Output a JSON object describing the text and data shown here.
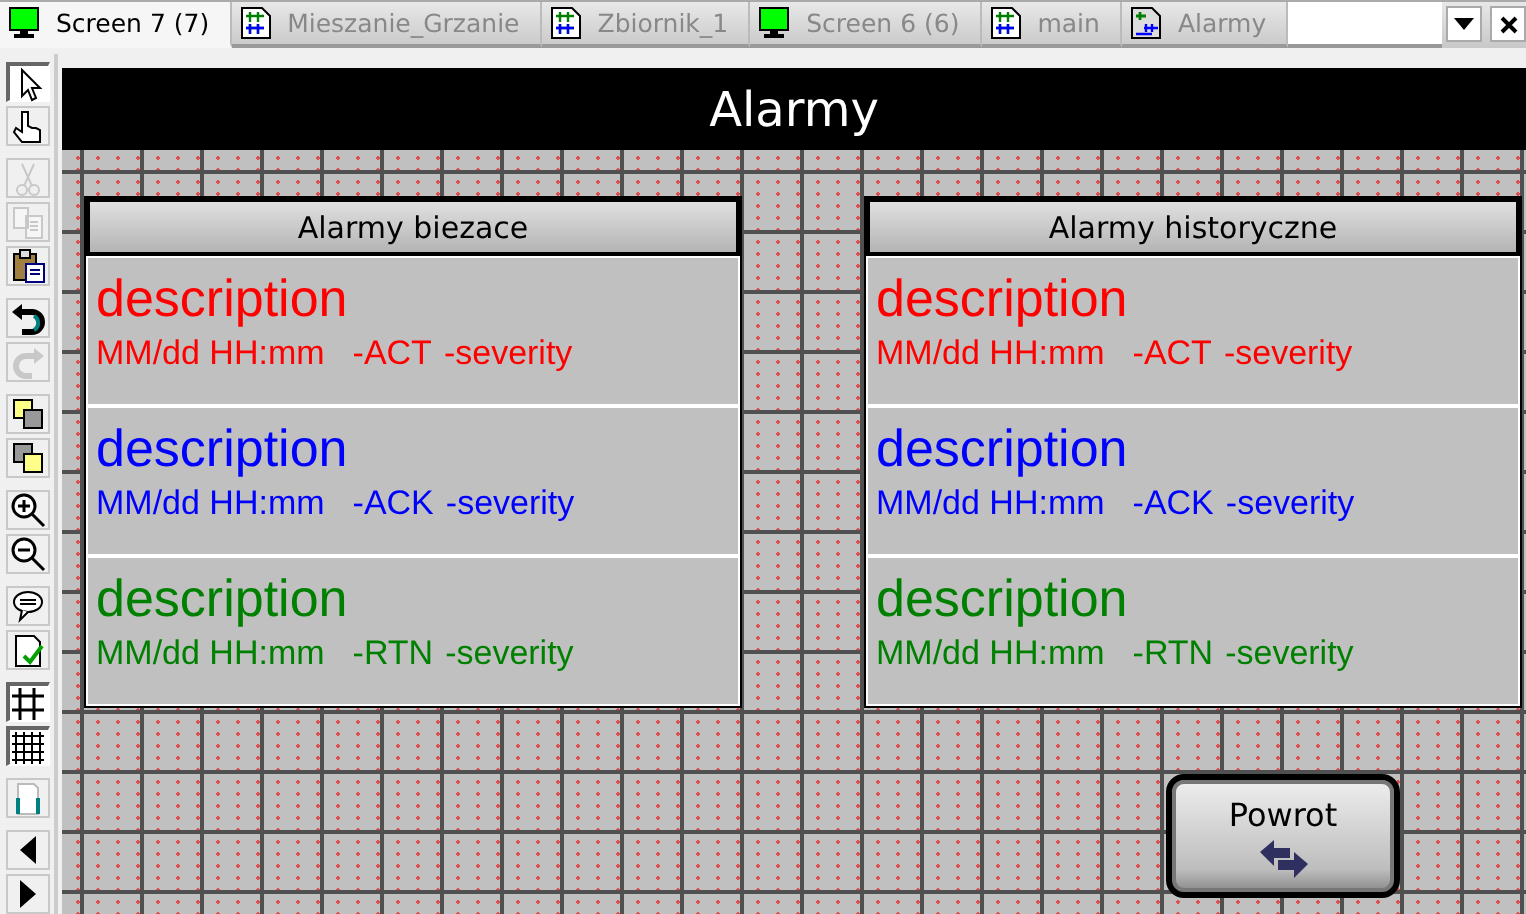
{
  "tabs": [
    {
      "label": "Screen 7 (7)",
      "kind": "screen",
      "selected": true
    },
    {
      "label": "Mieszanie_Grzanie",
      "kind": "ladder",
      "selected": false
    },
    {
      "label": "Zbiornik_1",
      "kind": "ladder",
      "selected": false
    },
    {
      "label": "Screen 6 (6)",
      "kind": "screen",
      "selected": false
    },
    {
      "label": "main",
      "kind": "ladder",
      "selected": false
    },
    {
      "label": "Alarmy",
      "kind": "alarm",
      "selected": false
    }
  ],
  "toolbar": [
    {
      "tools": [
        {
          "kind": "pointer",
          "pressed": true,
          "disabled": false
        },
        {
          "kind": "hand",
          "pressed": false,
          "disabled": false
        }
      ]
    },
    {
      "tools": [
        {
          "kind": "cut",
          "pressed": false,
          "disabled": true
        },
        {
          "kind": "copy",
          "pressed": false,
          "disabled": true
        },
        {
          "kind": "paste",
          "pressed": false,
          "disabled": false
        }
      ]
    },
    {
      "tools": [
        {
          "kind": "undo",
          "pressed": false,
          "disabled": false
        },
        {
          "kind": "redo",
          "pressed": false,
          "disabled": true
        }
      ]
    },
    {
      "tools": [
        {
          "kind": "front",
          "pressed": false,
          "disabled": false
        },
        {
          "kind": "back",
          "pressed": false,
          "disabled": false
        }
      ]
    },
    {
      "tools": [
        {
          "kind": "zoomin",
          "pressed": false,
          "disabled": false
        },
        {
          "kind": "zoomout",
          "pressed": false,
          "disabled": false
        }
      ]
    },
    {
      "tools": [
        {
          "kind": "comment",
          "pressed": false,
          "disabled": false
        },
        {
          "kind": "verify",
          "pressed": false,
          "disabled": false
        }
      ]
    },
    {
      "tools": [
        {
          "kind": "grid",
          "pressed": true,
          "disabled": false
        },
        {
          "kind": "finegrid",
          "pressed": true,
          "disabled": false
        }
      ]
    },
    {
      "tools": [
        {
          "kind": "page",
          "pressed": false,
          "disabled": false
        }
      ]
    },
    {
      "tools": [
        {
          "kind": "left",
          "pressed": false,
          "disabled": false
        },
        {
          "kind": "right",
          "pressed": false,
          "disabled": false
        }
      ]
    }
  ],
  "screen_title": "Alarmy",
  "panels": [
    {
      "title": "Alarmy biezace",
      "rows": [
        {
          "description": "description",
          "time": "MM/dd HH:mm",
          "state": "-ACT",
          "severity": "-severity",
          "color": "#ff0000"
        },
        {
          "description": "description",
          "time": "MM/dd HH:mm",
          "state": "-ACK",
          "severity": "-severity",
          "color": "#0000ff"
        },
        {
          "description": "description",
          "time": "MM/dd HH:mm",
          "state": "-RTN",
          "severity": "-severity",
          "color": "#008000"
        }
      ]
    },
    {
      "title": "Alarmy historyczne",
      "rows": [
        {
          "description": "description",
          "time": "MM/dd HH:mm",
          "state": "-ACT",
          "severity": "-severity",
          "color": "#ff0000"
        },
        {
          "description": "description",
          "time": "MM/dd HH:mm",
          "state": "-ACK",
          "severity": "-severity",
          "color": "#0000ff"
        },
        {
          "description": "description",
          "time": "MM/dd HH:mm",
          "state": "-RTN",
          "severity": "-severity",
          "color": "#008000"
        }
      ]
    }
  ],
  "back_button": {
    "label": "Powrot"
  }
}
